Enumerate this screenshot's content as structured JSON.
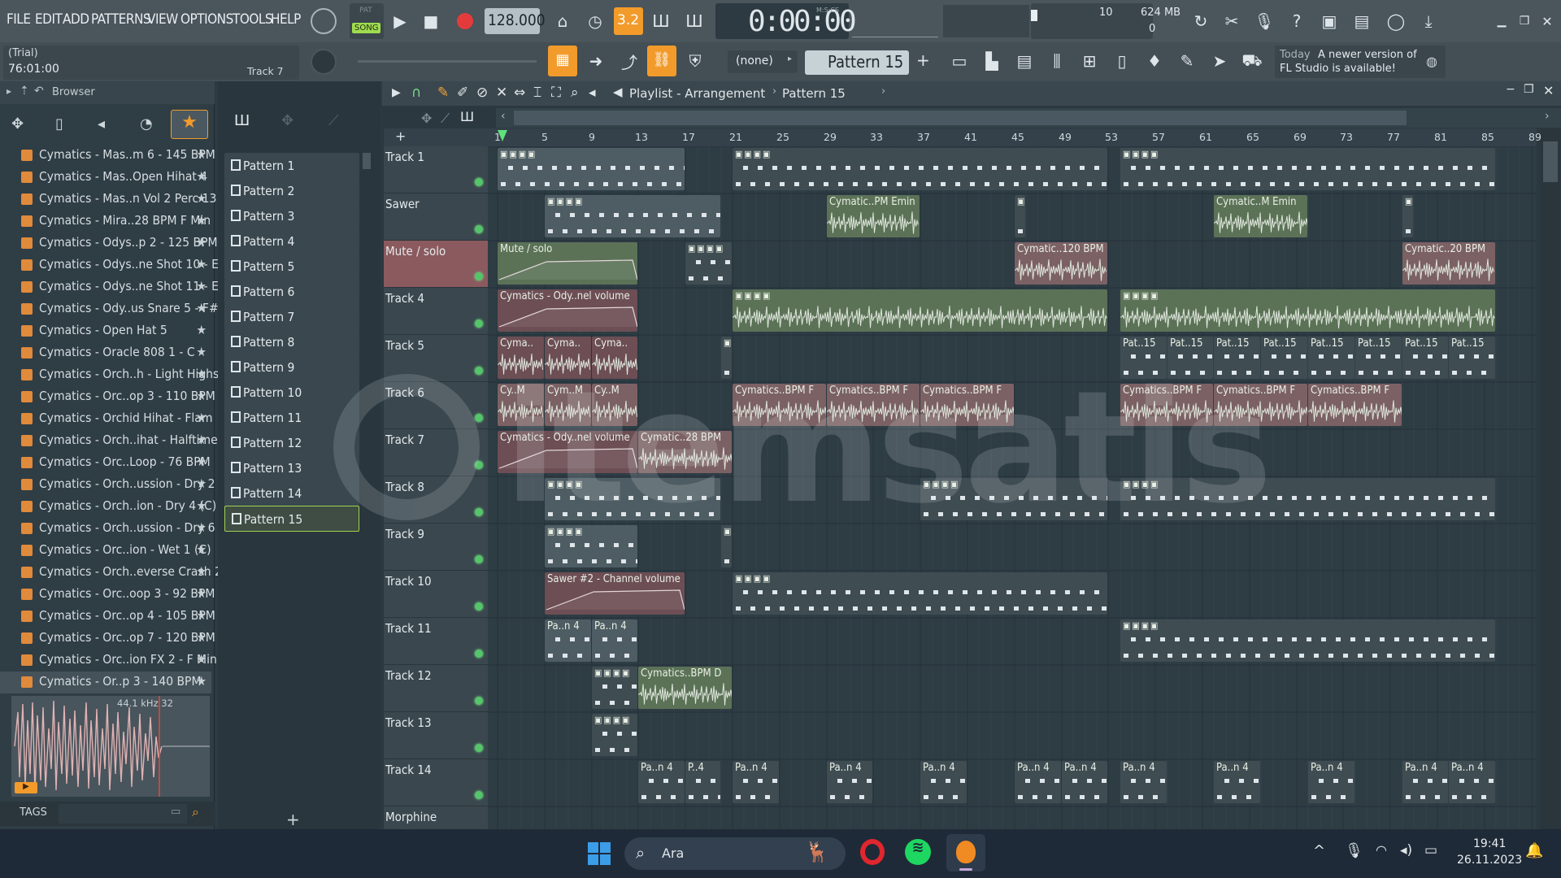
{
  "menu": [
    "FILE",
    "EDIT",
    "ADD",
    "PATTERNS",
    "VIEW",
    "OPTIONS",
    "TOOLS",
    "HELP"
  ],
  "transport": {
    "pat_label": "PAT",
    "song_label": "SONG",
    "tempo": "128.000",
    "time": "0:00:00",
    "time_unit": "M:S:CS",
    "cpu_top": "10",
    "ram": "624 MB",
    "cpu_bottom": "0",
    "step": "3.2"
  },
  "info": {
    "trial": "(Trial)",
    "position": "76:01:00",
    "track_hint": "Track 7"
  },
  "toolbar": {
    "snap": "(none)",
    "pattern": "Pattern 15",
    "news_day": "Today",
    "news_text_1": "A newer version of",
    "news_text_2": "FL Studio is available!"
  },
  "browser": {
    "title": "Browser",
    "items": [
      "Cymatics - Mas..m 6 - 145 BPM",
      "Cymatics - Mas..Open Hihat 4",
      "Cymatics - Mas..n Vol 2 Perc 13",
      "Cymatics - Mira..28 BPM F Min",
      "Cymatics - Odys..p 2 - 125 BPM",
      "Cymatics - Odys..ne Shot 10 - E",
      "Cymatics - Odys..ne Shot 11 - E",
      "Cymatics - Ody..us Snare 5 - F#",
      "Cymatics - Open Hat 5",
      "Cymatics - Oracle 808 1 - C",
      "Cymatics - Orch..h - Light Highs",
      "Cymatics - Orc..op 3 - 110 BPM",
      "Cymatics - Orchid Hihat - Flam",
      "Cymatics - Orch..ihat - Halftime",
      "Cymatics - Orc..Loop - 76 BPM",
      "Cymatics - Orch..ussion - Dry 2",
      "Cymatics - Orch..ion - Dry 4 (C)",
      "Cymatics - Orch..ussion - Dry 6",
      "Cymatics - Orc..ion - Wet 1 (C)",
      "Cymatics - Orch..everse Crash 2",
      "Cymatics - Orc..oop 3 - 92 BPM",
      "Cymatics - Orc..op 4 - 105 BPM",
      "Cymatics - Orc..op 7 - 120 BPM",
      "Cymatics - Orc..ion FX 2 - F Min",
      "Cymatics - Or..p 3 - 140 BPM"
    ],
    "sample_info": "44.1 kHz 32",
    "tags_label": "TAGS"
  },
  "patterns": [
    "Pattern 1",
    "Pattern 2",
    "Pattern 3",
    "Pattern 4",
    "Pattern 5",
    "Pattern 6",
    "Pattern 7",
    "Pattern 8",
    "Pattern 9",
    "Pattern 10",
    "Pattern 11",
    "Pattern 12",
    "Pattern 13",
    "Pattern 14",
    "Pattern 15"
  ],
  "playlist": {
    "breadcrumb_1": "Playlist - Arrangement",
    "breadcrumb_2": "Pattern 15",
    "ruler": [
      "1",
      "5",
      "9",
      "13",
      "17",
      "21",
      "25",
      "29",
      "33",
      "37",
      "41",
      "45",
      "49",
      "53",
      "57",
      "61",
      "65",
      "69",
      "73",
      "77",
      "81",
      "85",
      "89"
    ],
    "tracks": [
      "Track 1",
      "Sawer",
      "Mute / solo",
      "Track 4",
      "Track 5",
      "Track 6",
      "Track 7",
      "Track 8",
      "Track 9",
      "Track 10",
      "Track 11",
      "Track 12",
      "Track 13",
      "Track 14",
      "Morphine"
    ],
    "clip_labels": {
      "sawer_a": "Cymatic..PM Emin",
      "sawer_b": "Cymatic..M Emin",
      "mute": "Mute / solo",
      "mute_b": "Cymatic..120 BPM",
      "mute_c": "Cymatic..20 BPM",
      "t4": "Cymatics - Ody..nel volume",
      "t5a": "Cyma..",
      "t5b": "Cyma..",
      "t5c": "Cyma..",
      "t5p": "Pat..15",
      "t6a": "Cy..M",
      "t6b": "Cym..M",
      "t6c": "Cy..M",
      "t6d": "Cymatics..BPM F",
      "t7a": "Cymatics - Ody..nel volume",
      "t7b": "Cymatic..28 BPM",
      "t10": "Sawer #2 - Channel volume",
      "t11": "Pa..n 4",
      "t12": "Cymatics..BPM D",
      "t14": "Pa..n 4",
      "t14b": "P..4"
    }
  },
  "watermark": "itemsatis",
  "taskbar": {
    "search": "Ara",
    "time": "19:41",
    "date": "26.11.2023"
  }
}
